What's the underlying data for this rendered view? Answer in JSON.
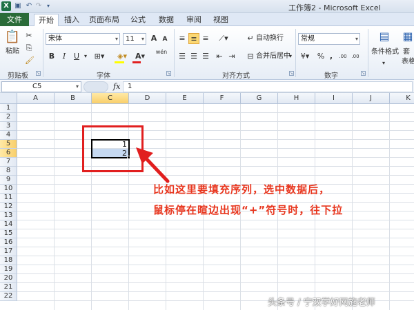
{
  "window": {
    "title": "工作簿2 - Microsoft Excel",
    "app_logo": "X"
  },
  "quick_access": {
    "save_icon": "save-icon",
    "undo_icon": "undo-icon",
    "redo_icon": "redo-icon"
  },
  "tabs": [
    {
      "label": "文件"
    },
    {
      "label": "开始"
    },
    {
      "label": "插入"
    },
    {
      "label": "页面布局"
    },
    {
      "label": "公式"
    },
    {
      "label": "数据"
    },
    {
      "label": "审阅"
    },
    {
      "label": "视图"
    }
  ],
  "ribbon": {
    "clipboard": {
      "paste": "粘贴",
      "label": "剪贴板"
    },
    "font": {
      "name": "宋体",
      "size": "11",
      "grow": "A",
      "shrink": "A",
      "bold": "B",
      "italic": "I",
      "underline": "U",
      "wen": "wén",
      "label": "字体"
    },
    "alignment": {
      "wrap": "自动换行",
      "merge": "合并后居中",
      "label": "对齐方式"
    },
    "number": {
      "format": "常规",
      "label": "数字",
      "inc_decimal": ".00",
      "dec_decimal": ".00"
    },
    "styles": {
      "conditional": "条件格式",
      "table1": "套",
      "table2": "表格"
    }
  },
  "formula_bar": {
    "name_box": "C5",
    "fx": "fx",
    "value": "1"
  },
  "grid": {
    "columns": [
      "A",
      "B",
      "C",
      "D",
      "E",
      "F",
      "G",
      "H",
      "I",
      "J",
      "K"
    ],
    "rows": [
      "1",
      "2",
      "3",
      "4",
      "5",
      "6",
      "7",
      "8",
      "9",
      "10",
      "11",
      "12",
      "13",
      "14",
      "15",
      "16",
      "17",
      "18",
      "19",
      "20",
      "21",
      "22"
    ],
    "selected_column": "C",
    "selected_rows": [
      "5",
      "6"
    ],
    "cells": {
      "C5": "1",
      "C6": "2"
    }
  },
  "annotation": {
    "line1": "比如这里要填充序列，选中数据后，",
    "line2": "鼠标停在暄边出现“+”符号时，往下拉"
  },
  "watermark": "头条号 / 宁双学好网施老师",
  "colors": {
    "accent": "#2a6b38",
    "annotation": "#e8361e",
    "selection": "#c6d9f1"
  }
}
